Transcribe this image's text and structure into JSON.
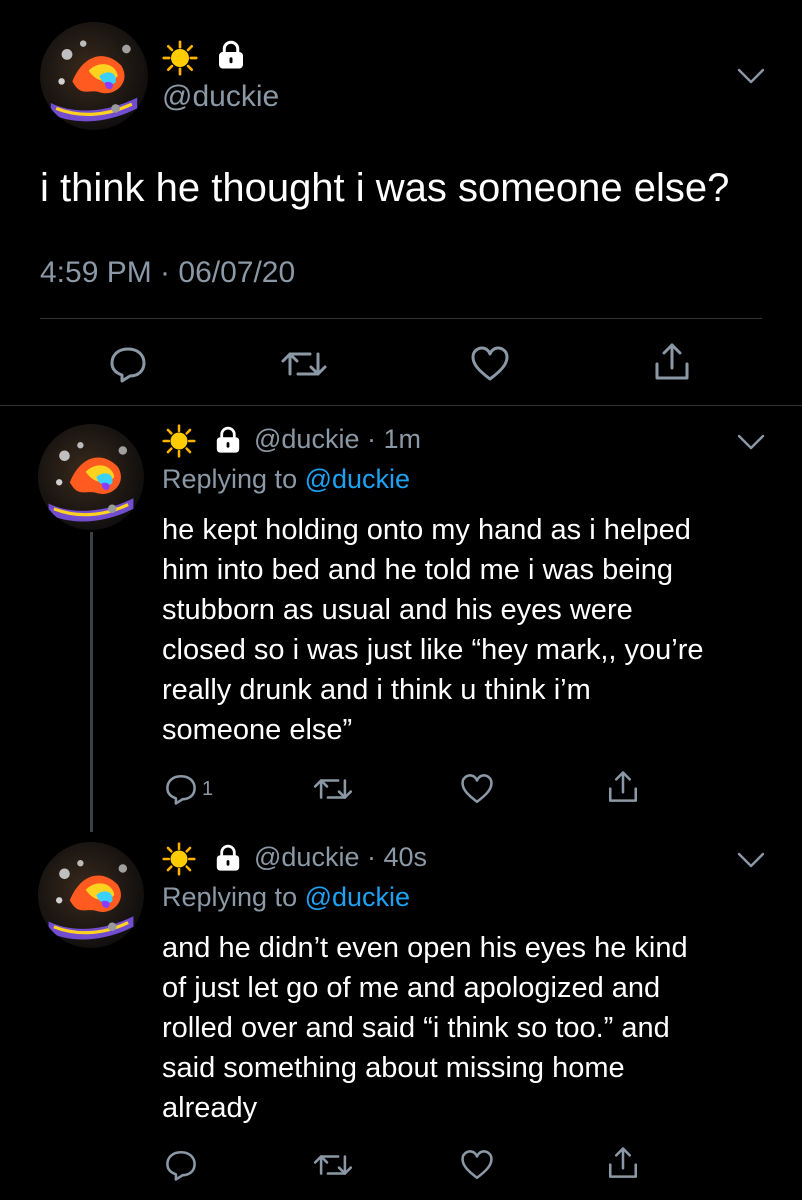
{
  "main_tweet": {
    "emoji": "☀️",
    "handle": "@duckie",
    "text": "i think he thought i was someone else?",
    "timestamp": "4:59 PM · 06/07/20"
  },
  "replies": [
    {
      "emoji": "☀️",
      "handle": "@duckie",
      "time": "1m",
      "replying_prefix": "Replying to",
      "replying_to": "@duckie",
      "lines": [
        "he kept holding onto my hand as i helped",
        "him into bed and he told me i was being",
        "stubborn as usual and his eyes were",
        "closed so i was just like “hey mark,, you’re",
        "really drunk and i think u think i’m",
        "someone else”"
      ],
      "reply_count": "1"
    },
    {
      "emoji": "☀️",
      "handle": "@duckie",
      "time": "40s",
      "replying_prefix": "Replying to",
      "replying_to": "@duckie",
      "lines": [
        "and he didn’t even open his eyes he kind",
        "of just let go of me and apologized and",
        "rolled over and said “i think so too.” and",
        "said something about missing home",
        "already"
      ],
      "reply_count": ""
    }
  ],
  "colors": {
    "background": "#000000",
    "text": "#ffffff",
    "muted": "#8b98a5",
    "link": "#1da1f2",
    "divider": "#2f3336"
  },
  "icons": [
    "sun-emoji",
    "lock-icon",
    "chevron-down-icon",
    "reply-icon",
    "retweet-icon",
    "like-icon",
    "share-icon"
  ]
}
